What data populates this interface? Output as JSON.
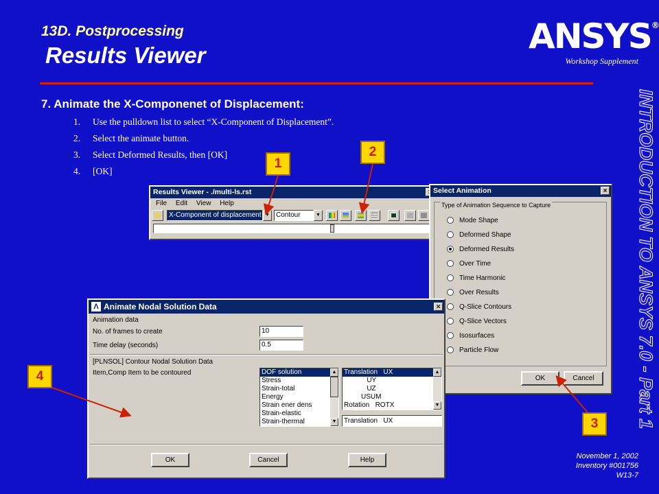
{
  "slide": {
    "subtitle": "13D. Postprocessing",
    "title": "Results Viewer",
    "logo": "ANSYS",
    "logo_mark": "®",
    "supplement": "Workshop Supplement",
    "side_text": "INTRODUCTION TO ANSYS 7.0 - Part 1",
    "step_heading": "7.  Animate the X-Componenet of Displacement:",
    "instructions": [
      {
        "num": "1.",
        "text": "Use the pulldown list to select “X-Component of Displacement”."
      },
      {
        "num": "2.",
        "text": "Select the animate button."
      },
      {
        "num": "3.",
        "text": "Select Deformed Results, then [OK]"
      },
      {
        "num": "4.",
        "text": "[OK]"
      }
    ],
    "footer": {
      "date": "November 1, 2002",
      "inventory": "Inventory #001756",
      "page": "W13-7"
    }
  },
  "results_viewer": {
    "title": "Results Viewer - ./multi-ls.rst",
    "menu": [
      "File",
      "Edit",
      "View",
      "Help"
    ],
    "component_select": "X-Component of displacement",
    "plot_type_select": "Contour",
    "dropdown_arrow": "▼"
  },
  "select_animation": {
    "title": "Select Animation",
    "group_label": "Type of Animation Sequence to Capture",
    "options": [
      "Mode Shape",
      "Deformed Shape",
      "Deformed Results",
      "Over Time",
      "Time Harmonic",
      "Over Results",
      "Q-Slice Contours",
      "Q-Slice Vectors",
      "Isosurfaces",
      "Particle Flow"
    ],
    "selected": "Deformed Results",
    "ok_label": "OK",
    "cancel_label": "Cancel"
  },
  "animate_nodal": {
    "title": "Animate Nodal Solution Data",
    "section_label": "Animation data",
    "frames_label": "No. of frames to create",
    "frames_value": "10",
    "delay_label": "Time delay (seconds)",
    "delay_value": "0.5",
    "plsol_label": "[PLNSOL]  Contour Nodal Solution Data",
    "item_label": "Item,Comp   Item to be contoured",
    "items": [
      "DOF solution",
      "Stress",
      "Strain-total",
      "Energy",
      "Strain ener dens",
      "Strain-elastic",
      "Strain-thermal"
    ],
    "components": [
      "Translation   UX",
      "            UY",
      "            UZ",
      "         USUM",
      "Rotation   ROTX"
    ],
    "component_value": "Translation   UX",
    "ok_label": "OK",
    "cancel_label": "Cancel",
    "help_label": "Help"
  },
  "callouts": [
    "1",
    "2",
    "3",
    "4"
  ],
  "colors": {
    "background": "#1010c8",
    "subtitle": "#ffff99",
    "callout": "#ffd700",
    "arrow": "#cc2200",
    "rule": "#d02020"
  }
}
